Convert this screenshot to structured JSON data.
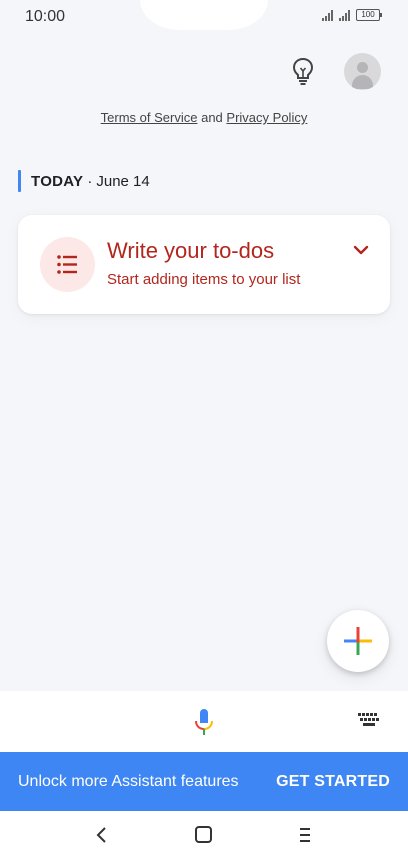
{
  "status_bar": {
    "time": "10:00",
    "battery": "100"
  },
  "header": {
    "bulb_icon": "lightbulb-icon",
    "avatar_icon": "account-avatar-icon"
  },
  "legal": {
    "terms": "Terms of Service",
    "and": "and",
    "privacy": "Privacy Policy"
  },
  "today": {
    "label": "TODAY",
    "separator": "·",
    "date": "June 14"
  },
  "card": {
    "icon": "list-icon",
    "title": "Write your to-dos",
    "subtitle": "Start adding items to your list",
    "expand_icon": "chevron-down-icon",
    "accent": "#b3261e",
    "icon_bg": "#fce8e6"
  },
  "fab": {
    "icon": "plus-icon"
  },
  "input_bar": {
    "mic_icon": "microphone-icon",
    "keyboard_icon": "keyboard-icon"
  },
  "banner": {
    "text": "Unlock more Assistant features",
    "button": "GET STARTED",
    "color": "#3d86f3"
  },
  "nav": {
    "back": "back-icon",
    "home": "home-icon",
    "menu": "menu-icon"
  }
}
